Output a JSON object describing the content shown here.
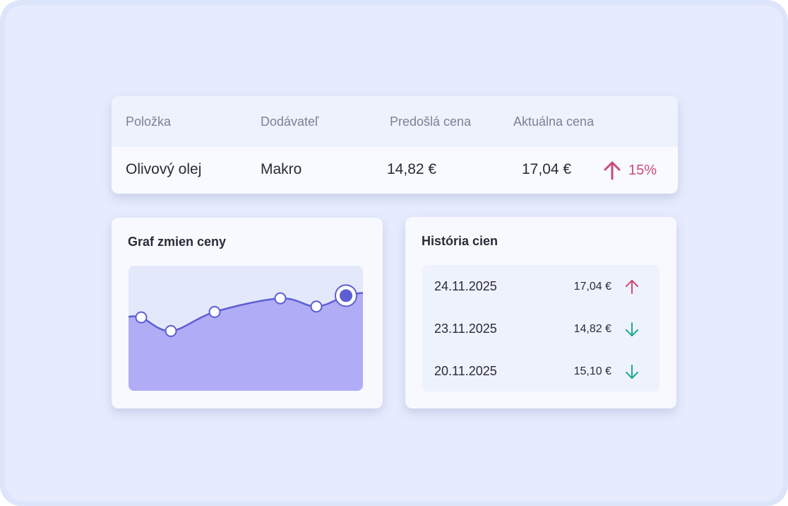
{
  "table": {
    "headers": [
      "Položka",
      "Dodávateľ",
      "Predošlá cena",
      "Aktuálna cena"
    ],
    "row": {
      "item": "Olivový olej",
      "supplier": "Makro",
      "previous_price": "14,82 €",
      "current_price": "17,04 €",
      "change": "15%",
      "change_direction": "up",
      "change_icon": "arrow-up-icon"
    }
  },
  "chart_card": {
    "title": "Graf zmien ceny"
  },
  "chart_data": {
    "type": "area",
    "title": "",
    "xlabel": "",
    "ylabel": "",
    "x": [
      1,
      2,
      3,
      4,
      5,
      6
    ],
    "values": [
      14.7,
      14.2,
      14.9,
      15.4,
      15.1,
      15.5
    ],
    "ylim": [
      12.0,
      16.6
    ],
    "grid": false,
    "highlight_last": true
  },
  "history": {
    "title": "História cien",
    "rows": [
      {
        "date": "24.11.2025",
        "price": "17,04 €",
        "direction": "up",
        "icon": "arrow-up-icon"
      },
      {
        "date": "23.11.2025",
        "price": "14,82 €",
        "direction": "down",
        "icon": "arrow-down-icon"
      },
      {
        "date": "20.11.2025",
        "price": "15,10 €",
        "direction": "down",
        "icon": "arrow-down-icon"
      }
    ]
  },
  "colors": {
    "background": "#e6ecfd",
    "card": "#f7f9fe",
    "accent": "#5d5ed3",
    "area_fill": "#b0acf6",
    "up": "#cc4a77",
    "down": "#1ba88f"
  }
}
